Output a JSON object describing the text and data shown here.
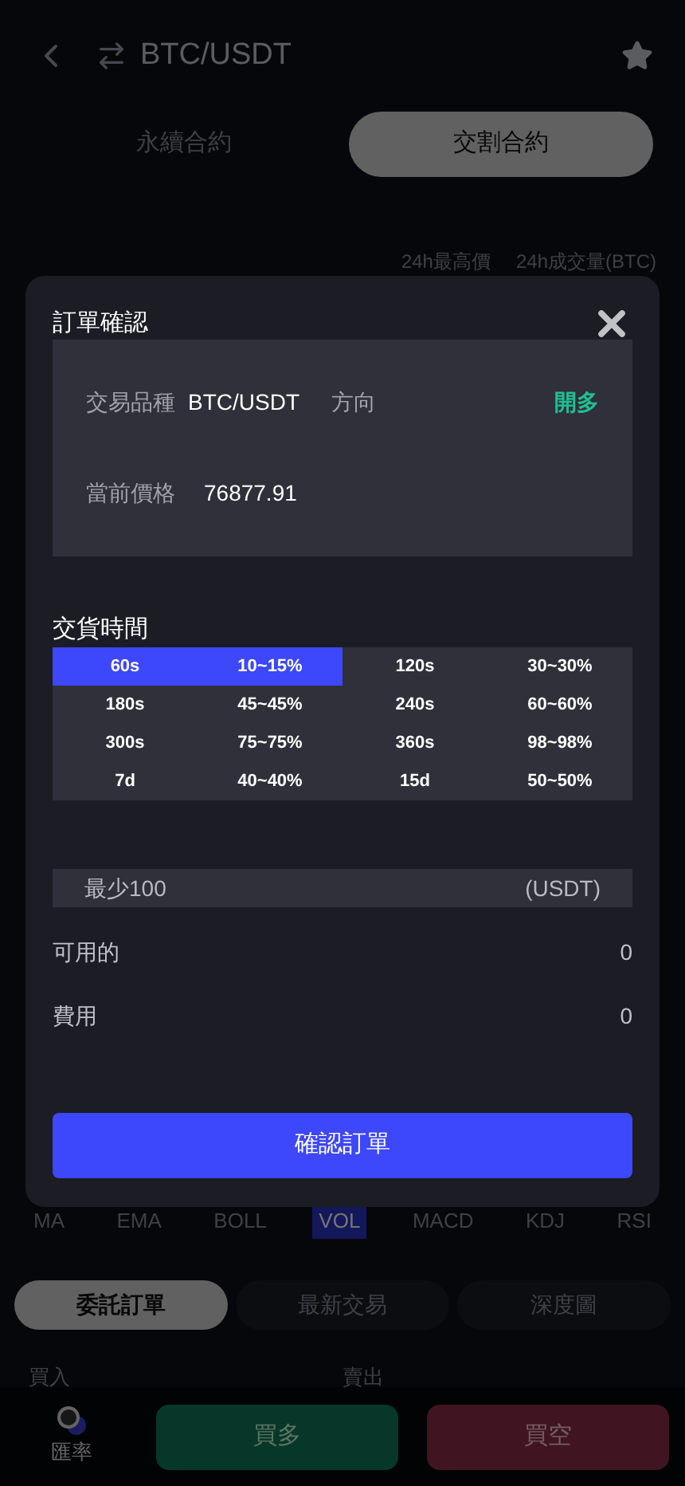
{
  "header": {
    "title": "BTC/USDT"
  },
  "contract_tabs": [
    {
      "label": "永續合約",
      "selected": false
    },
    {
      "label": "交割合約",
      "selected": true
    }
  ],
  "ticker": {
    "high_label": "24h最高價",
    "volume_label": "24h成交量(BTC)"
  },
  "indicators": [
    {
      "label": "MA",
      "selected": false
    },
    {
      "label": "EMA",
      "selected": false
    },
    {
      "label": "BOLL",
      "selected": false
    },
    {
      "label": "VOL",
      "selected": true
    },
    {
      "label": "MACD",
      "selected": false
    },
    {
      "label": "KDJ",
      "selected": false
    },
    {
      "label": "RSI",
      "selected": false
    }
  ],
  "book_tabs": [
    {
      "label": "委託訂單",
      "selected": true
    },
    {
      "label": "最新交易",
      "selected": false
    },
    {
      "label": "深度圖",
      "selected": false
    }
  ],
  "book_columns": [
    "買入",
    "賣出"
  ],
  "bottom_bar": {
    "rate_label": "匯率",
    "buy": "買多",
    "sell": "買空"
  },
  "dialog": {
    "title": "訂單確認",
    "symbol_label": "交易品種",
    "symbol": "BTC/USDT",
    "direction_label": "方向",
    "direction": "開多",
    "price_label": "當前價格",
    "price": "76877.91",
    "delivery_title": "交貨時間",
    "options": [
      {
        "time": "60s",
        "rate": "10~15%",
        "selected": true
      },
      {
        "time": "120s",
        "rate": "30~30%",
        "selected": false
      },
      {
        "time": "180s",
        "rate": "45~45%",
        "selected": false
      },
      {
        "time": "240s",
        "rate": "60~60%",
        "selected": false
      },
      {
        "time": "300s",
        "rate": "75~75%",
        "selected": false
      },
      {
        "time": "360s",
        "rate": "98~98%",
        "selected": false
      },
      {
        "time": "7d",
        "rate": "40~40%",
        "selected": false
      },
      {
        "time": "15d",
        "rate": "50~50%",
        "selected": false
      }
    ],
    "amount": {
      "placeholder": "最少100",
      "unit": "(USDT)"
    },
    "available_label": "可用的",
    "available": "0",
    "fee_label": "費用",
    "fee": "0",
    "confirm": "確認訂單"
  }
}
